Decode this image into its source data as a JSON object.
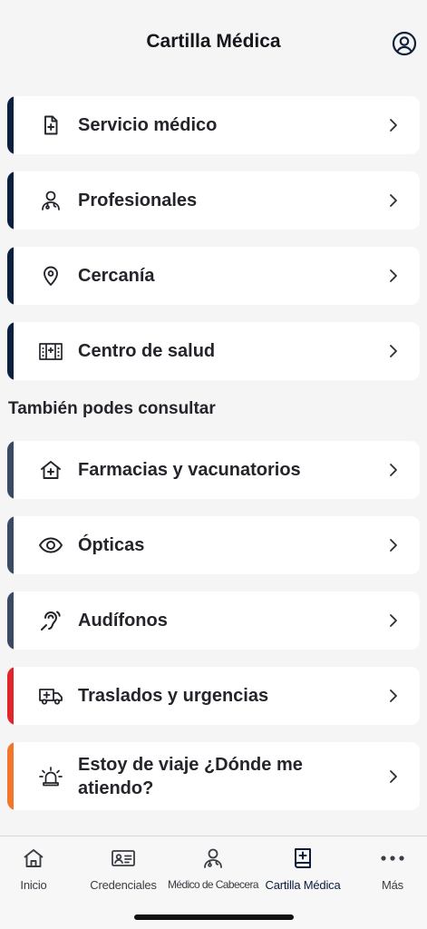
{
  "header": {
    "title": "Cartilla Médica",
    "profile_icon": "user-circle-icon"
  },
  "main_items": [
    {
      "label": "Servicio médico",
      "icon": "medical-file-icon",
      "accent": "#0b1f3f"
    },
    {
      "label": "Profesionales",
      "icon": "doctor-icon",
      "accent": "#0b1f3f"
    },
    {
      "label": "Cercanía",
      "icon": "location-pin-icon",
      "accent": "#0b1f3f"
    },
    {
      "label": "Centro de salud",
      "icon": "hospital-building-icon",
      "accent": "#0b1f3f"
    }
  ],
  "section": {
    "title": "También podes consultar"
  },
  "other_items": [
    {
      "label": "Farmacias y vacunatorios",
      "icon": "pharmacy-house-icon",
      "accent": "#3b4a63"
    },
    {
      "label": "Ópticas",
      "icon": "eye-icon",
      "accent": "#3b4a63"
    },
    {
      "label": "Audífonos",
      "icon": "hearing-icon",
      "accent": "#3b4a63"
    },
    {
      "label": "Traslados y urgencias",
      "icon": "ambulance-icon",
      "accent": "#e0262b"
    },
    {
      "label": "Estoy de viaje ¿Dónde me atiendo?",
      "icon": "emergency-siren-icon",
      "accent": "#f2772c"
    }
  ],
  "tabbar": {
    "tabs": [
      {
        "label": "Inicio",
        "icon": "home-icon"
      },
      {
        "label": "Credenciales",
        "icon": "id-card-icon"
      },
      {
        "label": "Médico de Cabecera",
        "icon": "doctor-icon"
      },
      {
        "label": "Cartilla Médica",
        "icon": "medical-book-icon",
        "active": true
      },
      {
        "label": "Más",
        "icon": "more-dots-icon"
      }
    ]
  }
}
